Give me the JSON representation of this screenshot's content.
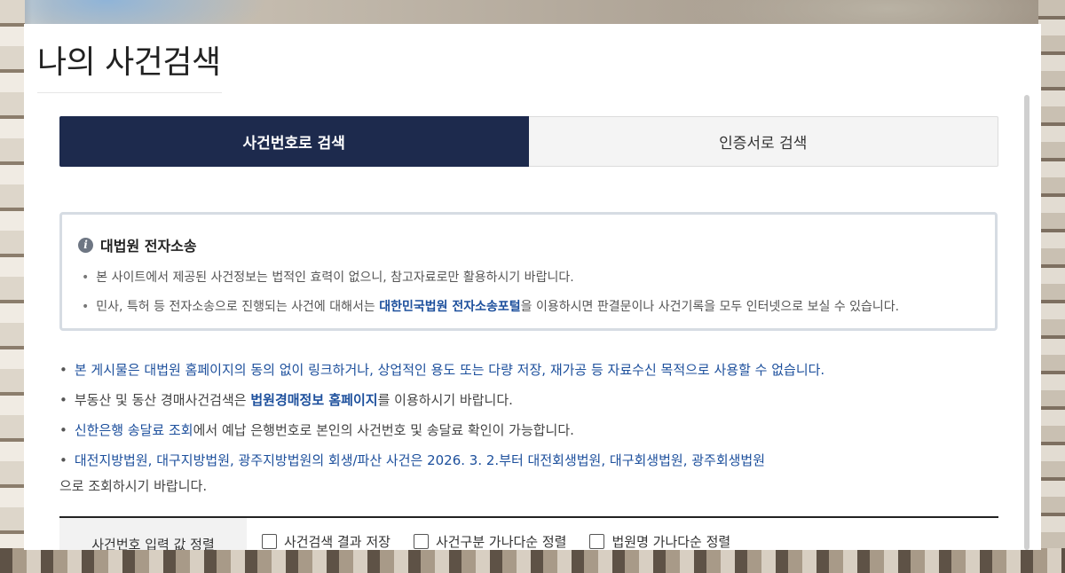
{
  "page": {
    "title": "나의 사건검색"
  },
  "tabs": [
    {
      "label": "사건번호로 검색",
      "active": true
    },
    {
      "label": "인증서로 검색",
      "active": false
    }
  ],
  "notice": {
    "heading": "대법원 전자소송",
    "line1": "본 사이트에서 제공된 사건정보는 법적인 효력이 없으니, 참고자료로만 활용하시기 바랍니다.",
    "line2_pre": "민사, 특허 등 전자소송으로 진행되는 사건에 대해서는 ",
    "line2_link": "대한민국법원 전자소송포털",
    "line2_post": "을 이용하시면 판결문이나 사건기록을 모두 인터넷으로 보실 수 있습니다."
  },
  "info": {
    "line1": "본 게시물은 대법원 홈페이지의 동의 없이 링크하거나, 상업적인 용도 또는 다량 저장, 재가공 등 자료수신 목적으로 사용할 수 없습니다.",
    "line2_pre": "부동산 및 동산 경매사건검색은 ",
    "line2_link": "법원경매정보 홈페이지",
    "line2_post": "를 이용하시기 바랍니다.",
    "line3_link": "신한은행 송달료 조회",
    "line3_post": "에서 예납 은행번호로 본인의 사건번호 및 송달료 확인이 가능합니다.",
    "line4_blue": "대전지방법원, 대구지방법원, 광주지방법원의 회생/파산 사건은 2026. 3. 2.부터 대전회생법원, 대구회생법원, 광주회생법원",
    "line4_cont": "으로 조회하시기 바랍니다."
  },
  "sort": {
    "label": "사건번호 입력 값 정렬",
    "options": [
      "사건검색 결과 저장",
      "사건구분 가나다순 정렬",
      "법원명 가나다순 정렬"
    ]
  },
  "colors": {
    "primary": "#1d2a4d",
    "link": "#1c4f9c"
  }
}
